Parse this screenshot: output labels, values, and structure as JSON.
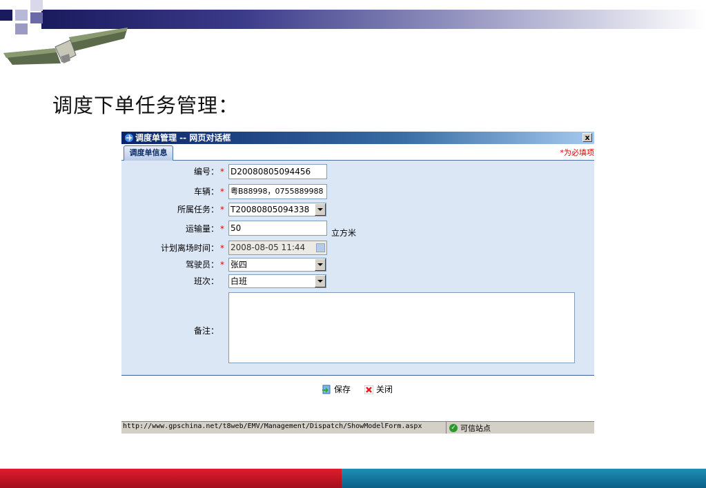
{
  "slide": {
    "title": "调度下单任务管理："
  },
  "dialog": {
    "title": "调度单管理 -- 网页对话框",
    "close_label": "x",
    "tab_label": "调度单信息",
    "required_note": "*为必填项",
    "fields": {
      "code": {
        "label": "编号：",
        "value": "D20080805094456"
      },
      "vehicle": {
        "label": "车辆：",
        "value": "粤B88998，0755889988"
      },
      "task": {
        "label": "所属任务：",
        "value": "T20080805094338"
      },
      "volume": {
        "label": "运输量：",
        "value": "50",
        "unit": "立方米"
      },
      "departure_time": {
        "label": "计划离场时间：",
        "value": "2008-08-05 11:44"
      },
      "driver": {
        "label": "驾驶员：",
        "value": "张四"
      },
      "shift": {
        "label": "班次：",
        "value": "白班"
      },
      "remark": {
        "label": "备注：",
        "value": ""
      }
    },
    "required_star": "*",
    "buttons": {
      "save": "保存",
      "close": "关闭"
    },
    "statusbar": {
      "url": "http://www.gpschina.net/t8web/EMV/Management/Dispatch/ShowModelForm.aspx",
      "zone": "可信站点"
    }
  },
  "colors": {
    "form_bg": "#dce7f5",
    "required": "#e00000",
    "titlebar": "#0a246a"
  }
}
